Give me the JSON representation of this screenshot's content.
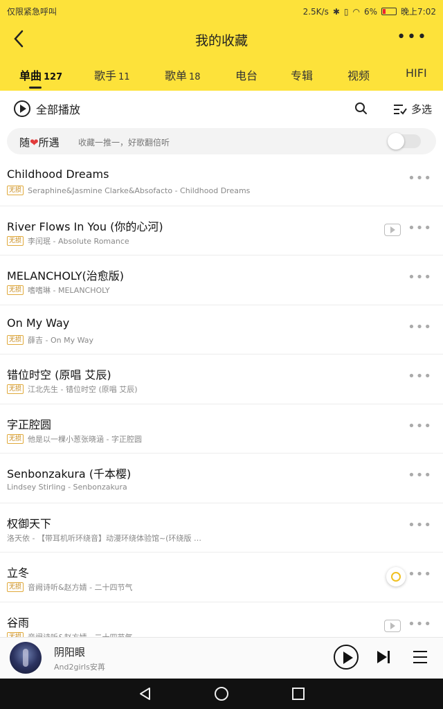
{
  "status_bar": {
    "left_text": "仅限紧急呼叫",
    "net_speed": "2.5K/s",
    "battery": "6%",
    "time": "晚上7:02"
  },
  "title_bar": {
    "title": "我的收藏"
  },
  "tabs": [
    {
      "label": "单曲",
      "count": "127",
      "active": true
    },
    {
      "label": "歌手",
      "count": "11"
    },
    {
      "label": "歌单",
      "count": "18"
    },
    {
      "label": "电台",
      "count": ""
    },
    {
      "label": "专辑",
      "count": ""
    },
    {
      "label": "视频",
      "count": ""
    },
    {
      "label": "HIFI",
      "count": ""
    }
  ],
  "toolbar": {
    "play_all": "全部播放",
    "multi_select": "多选"
  },
  "random_bar": {
    "title_pre": "随",
    "title_post": "所遇",
    "subtitle": "收藏一推一，好歌翻倍听",
    "toggle_on": false
  },
  "lossless_badge": "无损",
  "songs": [
    {
      "title": "Childhood Dreams",
      "subtitle": "Seraphine&Jasmine Clarke&Absofacto - Childhood Dreams",
      "lossless": true,
      "extra": ""
    },
    {
      "title": "River Flows In You (你的心河)",
      "subtitle": "李闰珉 - Absolute Romance",
      "lossless": true,
      "extra": "mv"
    },
    {
      "title": "MELANCHOLY(治愈版)",
      "subtitle": "嗜嗜琳 - MELANCHOLY",
      "lossless": true,
      "extra": ""
    },
    {
      "title": "On My Way",
      "subtitle": "薛吉 - On My Way",
      "lossless": true,
      "extra": ""
    },
    {
      "title": "错位时空 (原唱 艾辰)",
      "subtitle": "江北先生 - 错位时空 (原唱 艾辰)",
      "lossless": true,
      "extra": ""
    },
    {
      "title": "字正腔圆",
      "subtitle": "他是以一棵小葱张晓涵 - 字正腔圆",
      "lossless": true,
      "extra": ""
    },
    {
      "title": "Senbonzakura (千本樱)",
      "subtitle": "Lindsey Stirling - Senbonzakura",
      "lossless": false,
      "extra": ""
    },
    {
      "title": "权御天下",
      "subtitle": "洛天依 - 【带耳机听环绕音】动漫环绕体验馆~(环绕版 …",
      "lossless": false,
      "extra": ""
    },
    {
      "title": "立冬",
      "subtitle": "音阙诗听&赵方婧 - 二十四节气",
      "lossless": true,
      "extra": "locate"
    },
    {
      "title": "谷雨",
      "subtitle": "音阙诗听&赵方婧 - 二十四节气",
      "lossless": true,
      "extra": "mv"
    }
  ],
  "now_playing": {
    "title": "阴阳眼",
    "artist": "And2girls安苒"
  },
  "icons": {
    "back": "chevron-left-icon",
    "search": "search-icon",
    "multi_select": "checklist-icon",
    "heart": "heart-icon",
    "mv": "video-play-icon",
    "locate": "locate-icon",
    "play": "play-icon",
    "next": "skip-next-icon",
    "playlist": "playlist-icon"
  },
  "colors": {
    "header_bg": "#fde23a",
    "accent": "#f0c020",
    "heart": "#e23a3a",
    "lossless": "#c78a1a"
  }
}
